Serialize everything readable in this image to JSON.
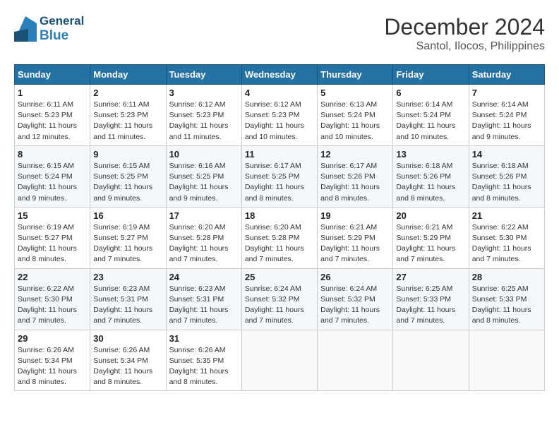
{
  "header": {
    "logo_general": "General",
    "logo_blue": "Blue",
    "month_title": "December 2024",
    "location": "Santol, Ilocos, Philippines"
  },
  "weekdays": [
    "Sunday",
    "Monday",
    "Tuesday",
    "Wednesday",
    "Thursday",
    "Friday",
    "Saturday"
  ],
  "weeks": [
    [
      {
        "day": "1",
        "sunrise": "6:11 AM",
        "sunset": "5:23 PM",
        "daylight": "11 hours and 12 minutes."
      },
      {
        "day": "2",
        "sunrise": "6:11 AM",
        "sunset": "5:23 PM",
        "daylight": "11 hours and 11 minutes."
      },
      {
        "day": "3",
        "sunrise": "6:12 AM",
        "sunset": "5:23 PM",
        "daylight": "11 hours and 11 minutes."
      },
      {
        "day": "4",
        "sunrise": "6:12 AM",
        "sunset": "5:23 PM",
        "daylight": "11 hours and 10 minutes."
      },
      {
        "day": "5",
        "sunrise": "6:13 AM",
        "sunset": "5:24 PM",
        "daylight": "11 hours and 10 minutes."
      },
      {
        "day": "6",
        "sunrise": "6:14 AM",
        "sunset": "5:24 PM",
        "daylight": "11 hours and 10 minutes."
      },
      {
        "day": "7",
        "sunrise": "6:14 AM",
        "sunset": "5:24 PM",
        "daylight": "11 hours and 9 minutes."
      }
    ],
    [
      {
        "day": "8",
        "sunrise": "6:15 AM",
        "sunset": "5:24 PM",
        "daylight": "11 hours and 9 minutes."
      },
      {
        "day": "9",
        "sunrise": "6:15 AM",
        "sunset": "5:25 PM",
        "daylight": "11 hours and 9 minutes."
      },
      {
        "day": "10",
        "sunrise": "6:16 AM",
        "sunset": "5:25 PM",
        "daylight": "11 hours and 9 minutes."
      },
      {
        "day": "11",
        "sunrise": "6:17 AM",
        "sunset": "5:25 PM",
        "daylight": "11 hours and 8 minutes."
      },
      {
        "day": "12",
        "sunrise": "6:17 AM",
        "sunset": "5:26 PM",
        "daylight": "11 hours and 8 minutes."
      },
      {
        "day": "13",
        "sunrise": "6:18 AM",
        "sunset": "5:26 PM",
        "daylight": "11 hours and 8 minutes."
      },
      {
        "day": "14",
        "sunrise": "6:18 AM",
        "sunset": "5:26 PM",
        "daylight": "11 hours and 8 minutes."
      }
    ],
    [
      {
        "day": "15",
        "sunrise": "6:19 AM",
        "sunset": "5:27 PM",
        "daylight": "11 hours and 8 minutes."
      },
      {
        "day": "16",
        "sunrise": "6:19 AM",
        "sunset": "5:27 PM",
        "daylight": "11 hours and 7 minutes."
      },
      {
        "day": "17",
        "sunrise": "6:20 AM",
        "sunset": "5:28 PM",
        "daylight": "11 hours and 7 minutes."
      },
      {
        "day": "18",
        "sunrise": "6:20 AM",
        "sunset": "5:28 PM",
        "daylight": "11 hours and 7 minutes."
      },
      {
        "day": "19",
        "sunrise": "6:21 AM",
        "sunset": "5:29 PM",
        "daylight": "11 hours and 7 minutes."
      },
      {
        "day": "20",
        "sunrise": "6:21 AM",
        "sunset": "5:29 PM",
        "daylight": "11 hours and 7 minutes."
      },
      {
        "day": "21",
        "sunrise": "6:22 AM",
        "sunset": "5:30 PM",
        "daylight": "11 hours and 7 minutes."
      }
    ],
    [
      {
        "day": "22",
        "sunrise": "6:22 AM",
        "sunset": "5:30 PM",
        "daylight": "11 hours and 7 minutes."
      },
      {
        "day": "23",
        "sunrise": "6:23 AM",
        "sunset": "5:31 PM",
        "daylight": "11 hours and 7 minutes."
      },
      {
        "day": "24",
        "sunrise": "6:23 AM",
        "sunset": "5:31 PM",
        "daylight": "11 hours and 7 minutes."
      },
      {
        "day": "25",
        "sunrise": "6:24 AM",
        "sunset": "5:32 PM",
        "daylight": "11 hours and 7 minutes."
      },
      {
        "day": "26",
        "sunrise": "6:24 AM",
        "sunset": "5:32 PM",
        "daylight": "11 hours and 7 minutes."
      },
      {
        "day": "27",
        "sunrise": "6:25 AM",
        "sunset": "5:33 PM",
        "daylight": "11 hours and 7 minutes."
      },
      {
        "day": "28",
        "sunrise": "6:25 AM",
        "sunset": "5:33 PM",
        "daylight": "11 hours and 8 minutes."
      }
    ],
    [
      {
        "day": "29",
        "sunrise": "6:26 AM",
        "sunset": "5:34 PM",
        "daylight": "11 hours and 8 minutes."
      },
      {
        "day": "30",
        "sunrise": "6:26 AM",
        "sunset": "5:34 PM",
        "daylight": "11 hours and 8 minutes."
      },
      {
        "day": "31",
        "sunrise": "6:26 AM",
        "sunset": "5:35 PM",
        "daylight": "11 hours and 8 minutes."
      },
      null,
      null,
      null,
      null
    ]
  ],
  "labels": {
    "sunrise": "Sunrise:",
    "sunset": "Sunset:",
    "daylight": "Daylight:"
  }
}
